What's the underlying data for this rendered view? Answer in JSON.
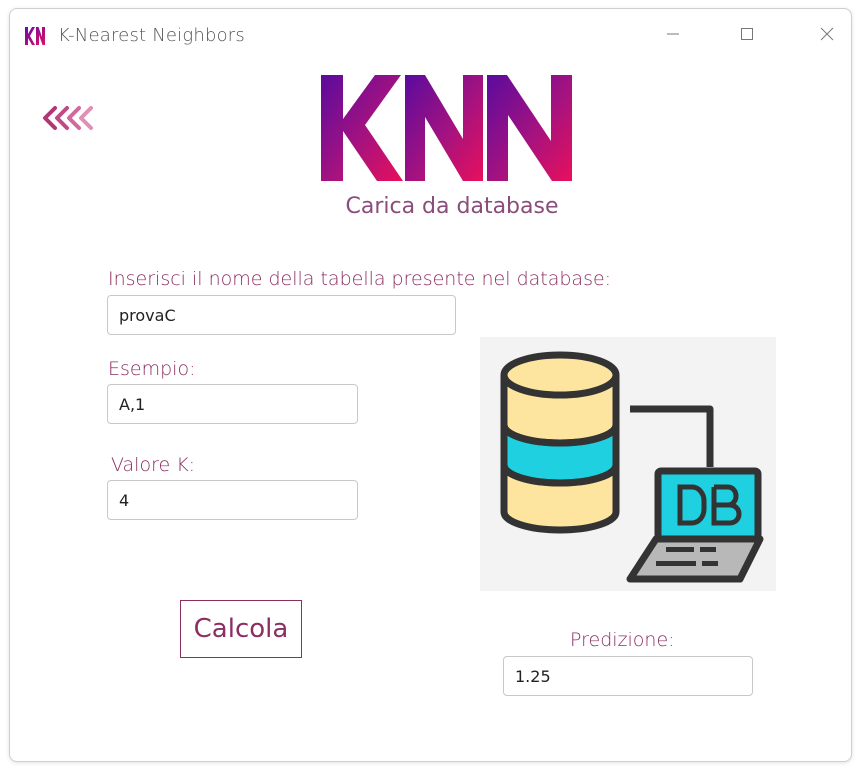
{
  "window": {
    "title": "K-Nearest Neighbors",
    "app_icon": "knn-app-icon",
    "controls": [
      "minimize-icon",
      "maximize-icon",
      "close-icon"
    ]
  },
  "header": {
    "back_icon": "back-arrows-icon",
    "logo_text": "KNN",
    "subtitle": "Carica da database"
  },
  "form": {
    "table_label": "Inserisci il nome della tabella presente nel database:",
    "table_value": "provaC",
    "example_label": "Esempio:",
    "example_value": "A,1",
    "k_label": "Valore K:",
    "k_value": "4",
    "calc_button": "Calcola",
    "prediction_label": "Predizione:",
    "prediction_value": "1.25"
  },
  "illustration": {
    "icon": "database-computer-icon",
    "screen_text": "DB"
  },
  "colors": {
    "accent": "#8b2f63",
    "logo_gradient_start": "#6a0aa8",
    "logo_gradient_end": "#e0115f",
    "db_yellow": "#fde5a0",
    "db_cyan": "#1fd0e0",
    "outline": "#333333"
  }
}
